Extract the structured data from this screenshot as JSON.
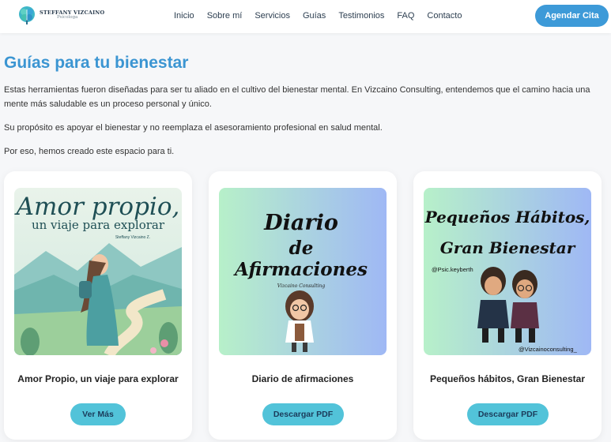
{
  "brand": {
    "name": "STEFFANY VIZCAINO",
    "subtitle": "Psicologa"
  },
  "nav": {
    "items": [
      "Inicio",
      "Sobre mí",
      "Servicios",
      "Guías",
      "Testimonios",
      "FAQ",
      "Contacto"
    ],
    "cta": "Agendar Cita"
  },
  "main": {
    "title": "Guías para tu bienestar",
    "paragraphs": [
      "Estas herramientas fueron diseñadas para ser tu aliado en el cultivo del bienestar mental. En Vizcaino Consulting, entendemos que el camino hacia una mente más saludable es un proceso personal y único.",
      "Su propósito es apoyar el bienestar y no reemplaza el asesoramiento profesional en salud mental.",
      "Por eso, hemos creado este espacio para ti."
    ]
  },
  "cards": [
    {
      "title": "Amor Propio, un viaje para explorar",
      "button": "Ver Más",
      "cover_lines": [
        "Amor propio,",
        "un viaje para explorar"
      ],
      "cover_author": "Steffany Vizcaino Z."
    },
    {
      "title": "Diario de afirmaciones",
      "button": "Descargar PDF",
      "cover_lines": [
        "Diario",
        "de",
        "Afirmaciones"
      ],
      "cover_author": "Vizcaino Consulting"
    },
    {
      "title": "Pequeños hábitos, Gran Bienestar",
      "button": "Descargar PDF",
      "cover_lines": [
        "Pequeños Hábitos,",
        "Gran Bienestar"
      ],
      "cover_handle_1": "@Psic.keyberth",
      "cover_handle_2": "@Vizcainoconsulting_"
    }
  ],
  "colors": {
    "accent": "#3b95d2",
    "cta": "#3d9ad8",
    "button": "#52c3d9"
  }
}
